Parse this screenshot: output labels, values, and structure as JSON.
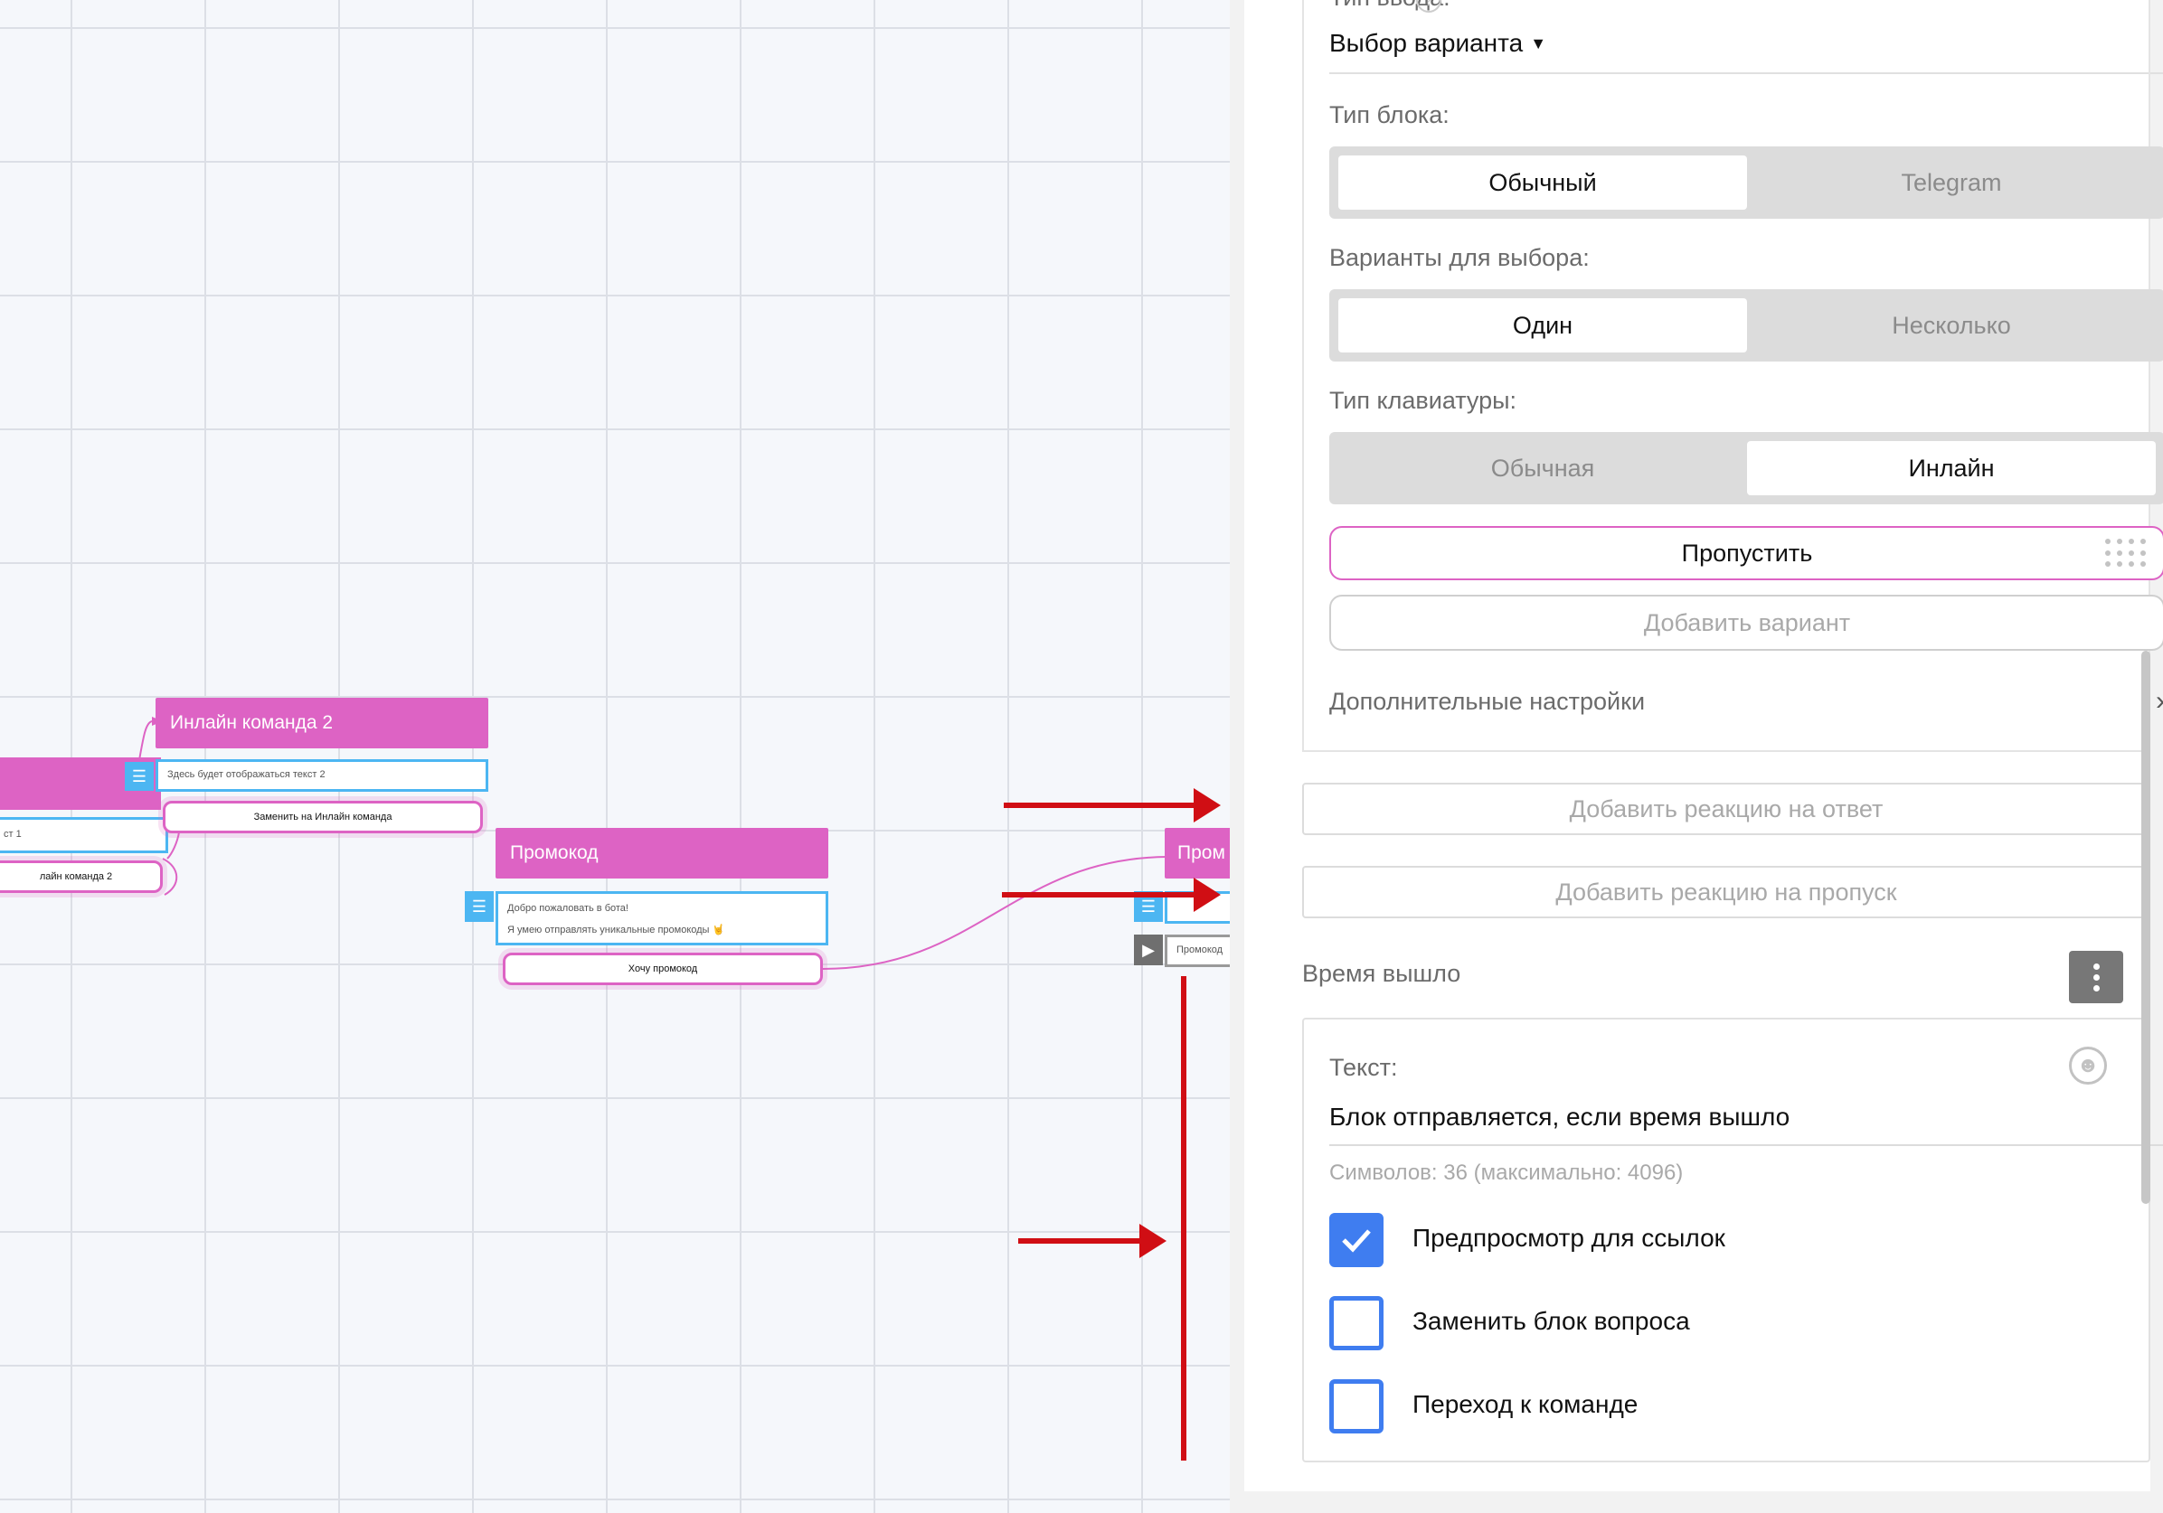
{
  "canvas": {
    "nodes": {
      "inline2": {
        "title": "Инлайн команда 2",
        "text": "Здесь будет отображаться текст 2",
        "button": "Заменить на Инлайн команда"
      },
      "left_partial": {
        "text": "ст 1",
        "button": "лайн команда 2"
      },
      "promo": {
        "title": "Промокод",
        "text_line1": "Добро пожаловать в бота!",
        "text_line2": "Я умею отправлять уникальные промокоды 🤘",
        "button": "Хочу промокод"
      },
      "promo_partial": {
        "title": "Пром",
        "text": "Промокод"
      }
    },
    "colors": {
      "node": "#dd63c4",
      "text_block": "#4cb6f2",
      "annotation": "#d00e14"
    }
  },
  "panel": {
    "input_type_label": "Тип ввода:",
    "input_type_value": "Выбор варианта",
    "block_type": {
      "label": "Тип блока:",
      "options": [
        "Обычный",
        "Telegram"
      ],
      "selected": "Обычный"
    },
    "choice_variants": {
      "label": "Варианты для выбора:",
      "options": [
        "Один",
        "Несколько"
      ],
      "selected": "Один"
    },
    "keyboard_type": {
      "label": "Тип клавиатуры:",
      "options": [
        "Обычная",
        "Инлайн"
      ],
      "selected": "Инлайн"
    },
    "variant_button": "Пропустить",
    "add_variant": "Добавить вариант",
    "advanced_settings": "Дополнительные настройки",
    "add_answer_reaction": "Добавить реакцию на ответ",
    "add_skip_reaction": "Добавить реакцию на пропуск",
    "timeout_section": {
      "title": "Время вышло",
      "text_label": "Текст:",
      "text_value": "Блок отправляется, если время вышло",
      "char_count": "Символов: 36 (максимально: 4096)",
      "checkboxes": [
        {
          "label": "Предпросмотр для ссылок",
          "checked": true
        },
        {
          "label": "Заменить блок вопроса",
          "checked": false
        },
        {
          "label": "Переход к команде",
          "checked": false
        }
      ]
    },
    "colors": {
      "accent_pink": "#dd63c4",
      "checkbox_blue": "#3f7df0"
    }
  }
}
